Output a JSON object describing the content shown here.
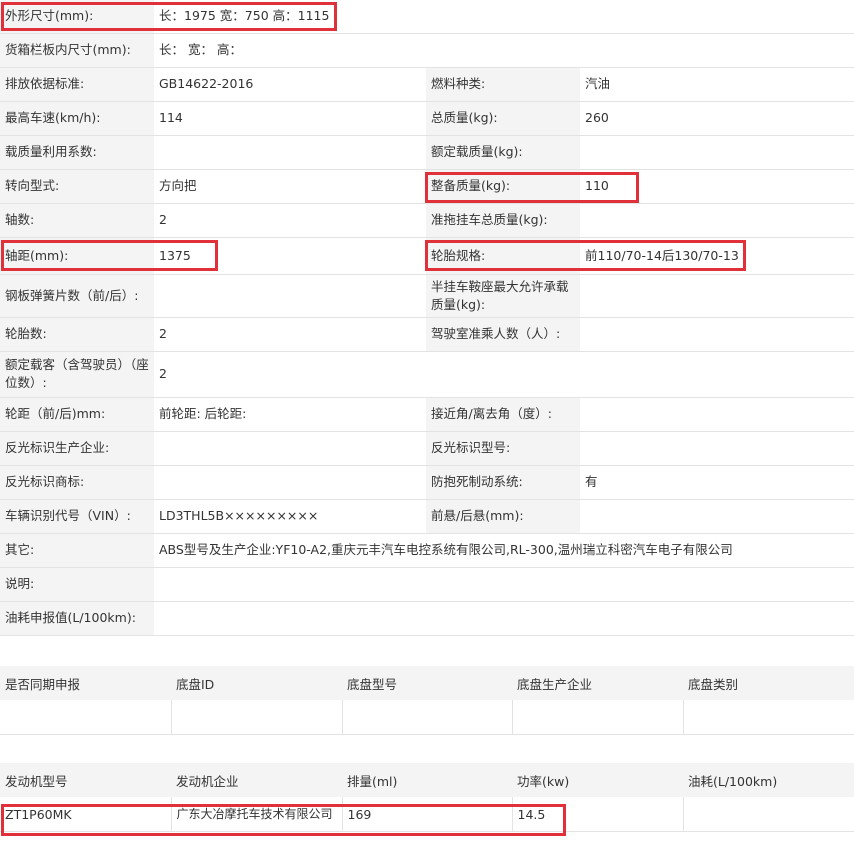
{
  "spec_rows": [
    {
      "l1": "外形尺寸(mm):",
      "v1": "长：1975 宽：750 高：1115"
    },
    {
      "l1": "货箱栏板内尺寸(mm):",
      "v1": "长：  宽：  高："
    },
    {
      "l1": "排放依据标准:",
      "v1": "GB14622-2016",
      "l2": "燃料种类:",
      "v2": "汽油"
    },
    {
      "l1": "最高车速(km/h):",
      "v1": "114",
      "l2": "总质量(kg):",
      "v2": "260"
    },
    {
      "l1": "载质量利用系数:",
      "v1": "",
      "l2": "额定载质量(kg):",
      "v2": ""
    },
    {
      "l1": "转向型式:",
      "v1": "方向把",
      "l2": "整备质量(kg):",
      "v2": "110"
    },
    {
      "l1": "轴数:",
      "v1": "2",
      "l2": "准拖挂车总质量(kg):",
      "v2": ""
    },
    {
      "l1": "轴距(mm):",
      "v1": "1375",
      "l2": "轮胎规格:",
      "v2": "前110/70-14后130/70-13"
    },
    {
      "l1": "钢板弹簧片数（前/后）:",
      "v1": "",
      "l2": "半挂车鞍座最大允许承载质量(kg):",
      "v2": ""
    },
    {
      "l1": "轮胎数:",
      "v1": "2",
      "l2": "驾驶室准乘人数（人）:",
      "v2": ""
    },
    {
      "l1": "额定载客（含驾驶员）（座位数）:",
      "v1": "2"
    },
    {
      "l1": "轮距（前/后)mm:",
      "v1": "前轮距: 后轮距:",
      "l2": "接近角/离去角（度）:",
      "v2": ""
    },
    {
      "l1": "反光标识生产企业:",
      "v1": "",
      "l2": "反光标识型号:",
      "v2": ""
    },
    {
      "l1": "反光标识商标:",
      "v1": "",
      "l2": "防抱死制动系统:",
      "v2": "有"
    },
    {
      "l1": "车辆识别代号（VIN）:",
      "v1": "LD3THL5B×××××××××",
      "l2": "前悬/后悬(mm):",
      "v2": ""
    },
    {
      "l1": "其它:",
      "v1": "ABS型号及生产企业:YF10-A2,重庆元丰汽车电控系统有限公司,RL-300,温州瑞立科密汽车电子有限公司"
    },
    {
      "l1": "说明:",
      "v1": ""
    },
    {
      "l1": "油耗申报值(L/100km):",
      "v1": ""
    }
  ],
  "chassis": {
    "headers": [
      "是否同期申报",
      "底盘ID",
      "底盘型号",
      "底盘生产企业",
      "底盘类别"
    ],
    "row": [
      "",
      "",
      "",
      "",
      ""
    ]
  },
  "engine": {
    "headers": [
      "发动机型号",
      "发动机企业",
      "排量(ml)",
      "功率(kw)",
      "油耗(L/100km)"
    ],
    "row": [
      "ZT1P60MK",
      "广东大冶摩托车技术有限公司",
      "169",
      "14.5",
      ""
    ]
  },
  "highlight_color": "#e0303a"
}
